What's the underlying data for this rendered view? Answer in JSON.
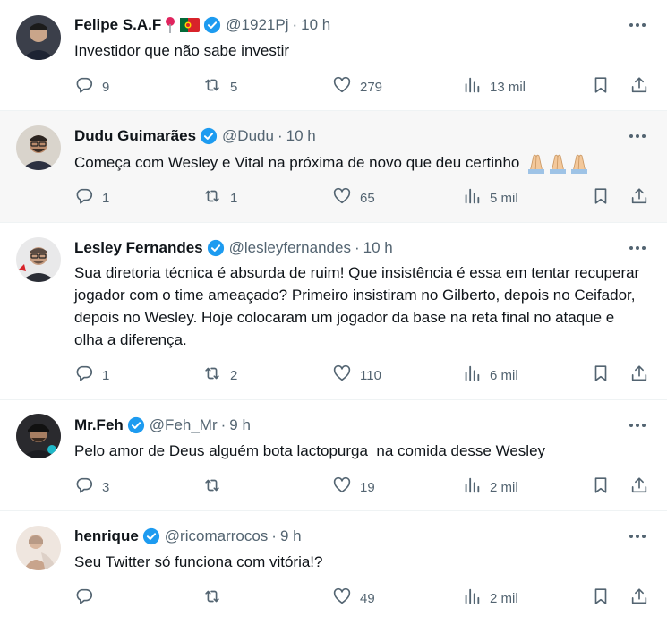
{
  "tweets": [
    {
      "name": "Felipe S.A.F",
      "handle": "@1921Pj",
      "time": "10 h",
      "text": "Investidor que não sabe investir",
      "reply": "9",
      "retweet": "5",
      "like": "279",
      "views": "13 mil"
    },
    {
      "name": "Dudu Guimarães",
      "handle": "@Dudu",
      "time": "10 h",
      "text": "Começa com Wesley e Vital na próxima de novo que deu certinho",
      "reply": "1",
      "retweet": "1",
      "like": "65",
      "views": "5 mil"
    },
    {
      "name": "Lesley Fernandes",
      "handle": "@lesleyfernandes",
      "time": "10 h",
      "text": "Sua diretoria técnica é absurda de ruim! Que insistência é essa em tentar recuperar jogador com o time ameaçado? Primeiro insistiram no Gilberto, depois no Ceifador, depois no Wesley. Hoje colocaram um jogador da base na reta final no ataque e olha a diferença.",
      "reply": "1",
      "retweet": "2",
      "like": "110",
      "views": "6 mil"
    },
    {
      "name": "Mr.Feh",
      "handle": "@Feh_Mr",
      "time": "9 h",
      "text": "Pelo amor de Deus alguém bota lactopurga  na comida desse Wesley",
      "reply": "3",
      "retweet": "",
      "like": "19",
      "views": "2 mil"
    },
    {
      "name": "henrique",
      "handle": "@ricomarrocos",
      "time": "9 h",
      "text": "Seu Twitter só funciona com vitória!?",
      "reply": "",
      "retweet": "",
      "like": "49",
      "views": "2 mil"
    }
  ],
  "colors": {
    "verified": "#1d9bf0",
    "secondary_text": "#536471",
    "highlight_bg": "#f7f7f7"
  },
  "icons": [
    "reply-icon",
    "retweet-icon",
    "like-icon",
    "views-icon",
    "bookmark-icon",
    "share-icon",
    "more-icon",
    "verified-badge-icon",
    "location-pin-icon",
    "portugal-flag-icon",
    "folded-hands-emoji"
  ]
}
